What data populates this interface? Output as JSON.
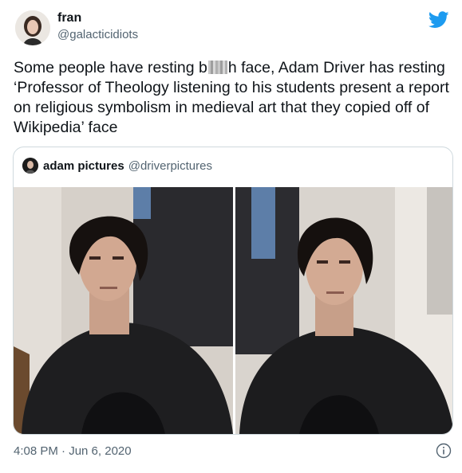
{
  "tweet": {
    "author_name": "fran",
    "author_handle": "@galacticidiots",
    "text_before": "Some people have resting b",
    "text_censored_tail": "h face, Adam Driver has resting ‘Professor of Theology listening to his students present a report on religious symbolism in medieval art that they copied off of Wikipedia’ face",
    "timestamp": "4:08 PM · Jun 6, 2020"
  },
  "quoted": {
    "author_name": "adam pictures",
    "author_handle": "@driverpictures"
  },
  "icons": {
    "brand": "twitter-bird-icon",
    "info": "info-icon"
  },
  "colors": {
    "twitter_blue": "#1d9bf0",
    "secondary_text": "#536471",
    "border": "#cfd9de"
  }
}
